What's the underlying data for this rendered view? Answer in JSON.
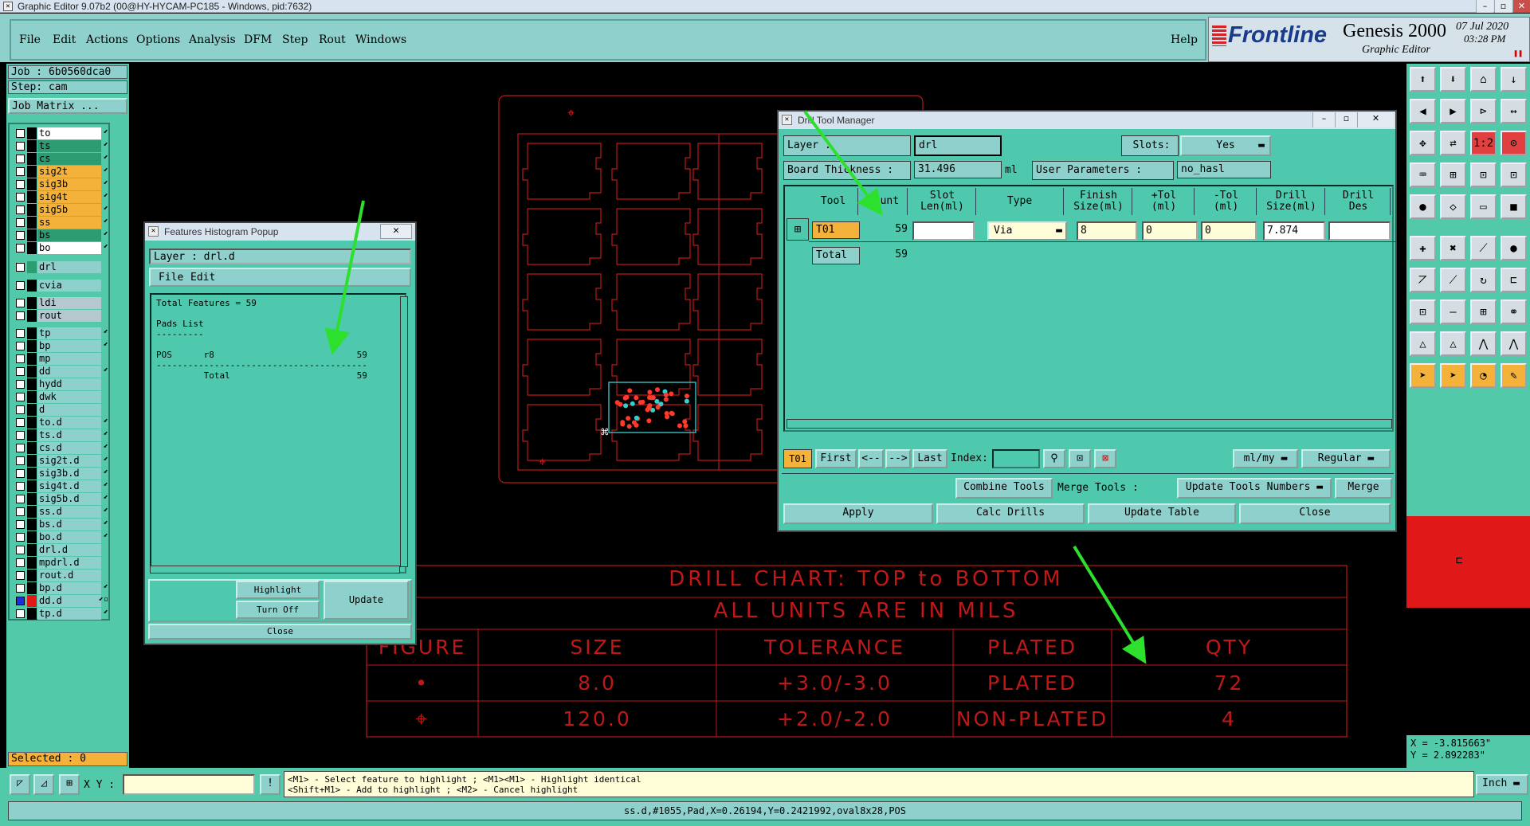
{
  "window": {
    "title": "Graphic Editor 9.07b2 (00@HY-HYCAM-PC185 - Windows, pid:7632)"
  },
  "menu": {
    "items": [
      "File",
      "Edit",
      "Actions",
      "Options",
      "Analysis",
      "DFM",
      "Step",
      "Rout",
      "Windows"
    ],
    "help": "Help"
  },
  "brand": {
    "logo": "Frontline",
    "product": "Genesis 2000",
    "subtitle": "Graphic Editor",
    "date": "07 Jul 2020",
    "time": "03:28 PM"
  },
  "job": {
    "label": "Job : 6b0560dca0",
    "step": "Step: cam",
    "matrix_button": "Job Matrix ..."
  },
  "layers": [
    {
      "name": "to",
      "swatch": "#000000",
      "bg": "#ffffff",
      "arrow": "⬋"
    },
    {
      "name": "ts",
      "swatch": "#000000",
      "bg": "#2e9c73",
      "arrow": "⬋"
    },
    {
      "name": "cs",
      "swatch": "#000000",
      "bg": "#2e9c73",
      "arrow": "⬋"
    },
    {
      "name": "sig2t",
      "swatch": "#000000",
      "bg": "#f4b23a",
      "arrow": "⬋"
    },
    {
      "name": "sig3b",
      "swatch": "#000000",
      "bg": "#f4b23a",
      "arrow": "⬋"
    },
    {
      "name": "sig4t",
      "swatch": "#000000",
      "bg": "#f4b23a",
      "arrow": "⬋"
    },
    {
      "name": "sig5b",
      "swatch": "#000000",
      "bg": "#f4b23a",
      "arrow": "⬋"
    },
    {
      "name": "ss",
      "swatch": "#000000",
      "bg": "#f4b23a",
      "arrow": "⬋"
    },
    {
      "name": "bs",
      "swatch": "#000000",
      "bg": "#2e9c73",
      "arrow": "⬋"
    },
    {
      "name": "bo",
      "swatch": "#000000",
      "bg": "#ffffff",
      "arrow": "⬋"
    },
    {
      "name": "drl",
      "swatch": "#2e9c73",
      "bg": "#8ed0cb",
      "arrow": ""
    },
    {
      "name": "cvia",
      "swatch": "#000000",
      "bg": "#8ed0cb",
      "arrow": ""
    },
    {
      "name": "ldi",
      "swatch": "#000000",
      "bg": "#b5c8d0",
      "arrow": ""
    },
    {
      "name": "rout",
      "swatch": "#000000",
      "bg": "#b5c8d0",
      "arrow": ""
    },
    {
      "name": "tp",
      "swatch": "#000000",
      "bg": "#8ed0cb",
      "arrow": "⬋"
    },
    {
      "name": "bp",
      "swatch": "#000000",
      "bg": "#8ed0cb",
      "arrow": "⬋"
    },
    {
      "name": "mp",
      "swatch": "#000000",
      "bg": "#8ed0cb",
      "arrow": ""
    },
    {
      "name": "dd",
      "swatch": "#000000",
      "bg": "#8ed0cb",
      "arrow": "⬋"
    },
    {
      "name": "hydd",
      "swatch": "#000000",
      "bg": "#8ed0cb",
      "arrow": ""
    },
    {
      "name": "dwk",
      "swatch": "#000000",
      "bg": "#8ed0cb",
      "arrow": ""
    },
    {
      "name": "d",
      "swatch": "#000000",
      "bg": "#8ed0cb",
      "arrow": ""
    },
    {
      "name": "to.d",
      "swatch": "#000000",
      "bg": "#8ed0cb",
      "arrow": "⬋"
    },
    {
      "name": "ts.d",
      "swatch": "#000000",
      "bg": "#8ed0cb",
      "arrow": "⬋"
    },
    {
      "name": "cs.d",
      "swatch": "#000000",
      "bg": "#8ed0cb",
      "arrow": "⬋"
    },
    {
      "name": "sig2t.d",
      "swatch": "#000000",
      "bg": "#8ed0cb",
      "arrow": "⬋"
    },
    {
      "name": "sig3b.d",
      "swatch": "#000000",
      "bg": "#8ed0cb",
      "arrow": "⬋"
    },
    {
      "name": "sig4t.d",
      "swatch": "#000000",
      "bg": "#8ed0cb",
      "arrow": "⬋"
    },
    {
      "name": "sig5b.d",
      "swatch": "#000000",
      "bg": "#8ed0cb",
      "arrow": "⬋"
    },
    {
      "name": "ss.d",
      "swatch": "#000000",
      "bg": "#8ed0cb",
      "arrow": "⬋"
    },
    {
      "name": "bs.d",
      "swatch": "#000000",
      "bg": "#8ed0cb",
      "arrow": "⬋"
    },
    {
      "name": "bo.d",
      "swatch": "#000000",
      "bg": "#8ed0cb",
      "arrow": "⬋"
    },
    {
      "name": "drl.d",
      "swatch": "#000000",
      "bg": "#8ed0cb",
      "arrow": ""
    },
    {
      "name": "mpdrl.d",
      "swatch": "#000000",
      "bg": "#8ed0cb",
      "arrow": ""
    },
    {
      "name": "rout.d",
      "swatch": "#000000",
      "bg": "#8ed0cb",
      "arrow": ""
    },
    {
      "name": "bp.d",
      "swatch": "#000000",
      "bg": "#8ed0cb",
      "arrow": "⬋"
    },
    {
      "name": "dd.d",
      "swatch": "#e01818",
      "bg": "#8ed0cb",
      "arrow": "⬋▫"
    },
    {
      "name": "tp.d",
      "swatch": "#000000",
      "bg": "#8ed0cb",
      "arrow": "⬋"
    }
  ],
  "selected": "Selected : 0",
  "histogram": {
    "title": "Features Histogram Popup",
    "layer": "Layer :  drl.d",
    "menu": [
      "File",
      "Edit"
    ],
    "lines": [
      "Total Features = 59",
      "",
      "Pads List",
      "---------",
      "",
      "POS      r8                           59",
      "----------------------------------------",
      "         Total                        59"
    ],
    "highlight": "Highlight",
    "turnoff": "Turn Off",
    "update": "Update",
    "close": "Close"
  },
  "drill": {
    "title": "Drill Tool Manager",
    "layer_label": "Layer          :",
    "layer_value": "drl",
    "slots_label": "Slots:",
    "slots_value": "Yes",
    "thick_label": "Board Thickness  :",
    "thick_value": "31.496",
    "thick_unit": "ml",
    "userparam_label": "User Parameters  :",
    "userparam_value": "no_hasl",
    "headers": [
      "Tool",
      "Count",
      "Slot\nLen(ml)",
      "Type",
      "Finish\nSize(ml)",
      "+Tol\n(ml)",
      "-Tol\n(ml)",
      "Drill\nSize(ml)",
      "Drill\nDes"
    ],
    "row": {
      "tool": "T01",
      "count": "59",
      "slot": "",
      "type": "Via",
      "finish": "8",
      "ptol": "0",
      "mtol": "0",
      "drill": "7.874",
      "des": ""
    },
    "total": {
      "label": "Total",
      "count": "59"
    },
    "nav": {
      "cur": "T01",
      "first": "First",
      "prev": "<--",
      "next": "-->",
      "last": "Last",
      "index": "Index:",
      "units": "ml/my",
      "mode": "Regular"
    },
    "row2": {
      "combine": "Combine Tools",
      "merge_label": "Merge Tools :",
      "update_numbers": "Update Tools Numbers",
      "merge": "Merge"
    },
    "row3": {
      "apply": "Apply",
      "calc": "Calc Drills",
      "update": "Update Table",
      "close": "Close"
    }
  },
  "chart": {
    "line1": "DRILL CHART: TOP to BOTTOM",
    "line2": "ALL UNITS ARE IN MILS",
    "headers": [
      "FIGURE",
      "SIZE",
      "TOLERANCE",
      "PLATED",
      "QTY"
    ],
    "rows": [
      [
        "•",
        "8.0",
        "+3.0/-3.0",
        "PLATED",
        "72"
      ],
      [
        "⌖",
        "120.0",
        "+2.0/-2.0",
        "NON-PLATED",
        "4"
      ]
    ]
  },
  "coords": {
    "x": "X = -3.815663\"",
    "y": "Y = 2.892283\""
  },
  "status": {
    "xy_label": "X Y :",
    "hint1": "<M1> - Select feature to highlight ; <M1><M1> - Highlight identical",
    "hint2": "<Shift+M1> - Add to highlight ; <M2> - Cancel highlight",
    "units": "Inch",
    "info": "ss.d,#1055,Pad,X=0.26194,Y=0.2421992,oval8x28,POS"
  }
}
